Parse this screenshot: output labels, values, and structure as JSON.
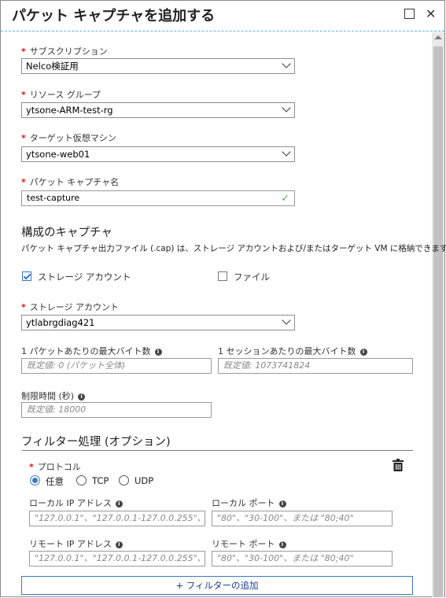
{
  "title": "パケット キャプチャを追加する",
  "subscription": {
    "label": "サブスクリプション",
    "value": "Nelco検証用"
  },
  "resource_group": {
    "label": "リソース グループ",
    "value": "ytsone-ARM-test-rg"
  },
  "target_vm": {
    "label": "ターゲット仮想マシン",
    "value": "ytsone-web01"
  },
  "capture_name": {
    "label": "パケット キャプチャ名",
    "value": "test-capture"
  },
  "capture_config": {
    "heading": "構成のキャプチャ",
    "description": "パケット キャプチャ出力ファイル (.cap) は、ストレージ アカウントおよび/またはターゲット VM に格納できます。",
    "storage_checkbox": "ストレージ アカウント",
    "storage_checked": true,
    "file_checkbox": "ファイル",
    "file_checked": false
  },
  "storage_account": {
    "label": "ストレージ アカウント",
    "value": "ytlabrgdiag421"
  },
  "max_bytes_packet": {
    "label": "1 パケットあたりの最大バイト数",
    "placeholder": "既定値: 0 (パケット全体)"
  },
  "max_bytes_session": {
    "label": "1 セッションあたりの最大バイト数",
    "placeholder": "既定値: 1073741824"
  },
  "time_limit": {
    "label": "制限時間 (秒)",
    "placeholder": "既定値: 18000"
  },
  "filter": {
    "heading": "フィルター処理 (オプション)",
    "protocol_label": "プロトコル",
    "protocols": [
      "任意",
      "TCP",
      "UDP"
    ],
    "selected_protocol": "任意",
    "local_ip": {
      "label": "ローカル IP アドレス",
      "placeholder": "\"127.0.0.1\"、\"127.0.0.1-127.0.0.255\"、ま..."
    },
    "local_port": {
      "label": "ローカル ポート",
      "placeholder": "\"80\"、\"30-100\"、または \"80;40\""
    },
    "remote_ip": {
      "label": "リモート IP アドレス",
      "placeholder": "\"127.0.0.1\"、\"127.0.0.1-127.0.0.255\"、ま..."
    },
    "remote_port": {
      "label": "リモート ポート",
      "placeholder": "\"80\"、\"30-100\"、または \"80;40\""
    },
    "add_button": "+ フィルターの追加"
  }
}
